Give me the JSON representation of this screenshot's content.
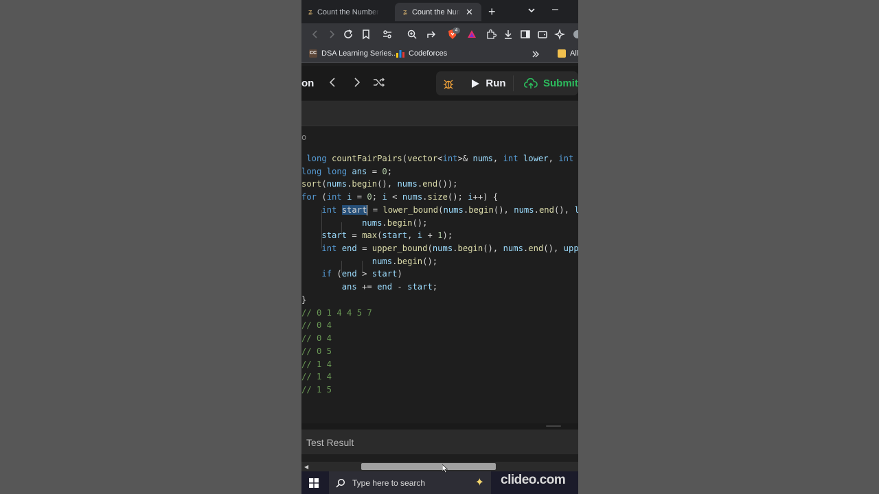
{
  "browser": {
    "tabs": [
      {
        "title": "Count the Number o"
      },
      {
        "title": "Count the Numb",
        "active": true
      }
    ],
    "bookmarks": [
      {
        "label": "DSA Learning Series..."
      },
      {
        "label": "Codeforces"
      },
      {
        "label": "All"
      }
    ],
    "brave_badge": "4"
  },
  "leetcode": {
    "title_fragment": "on",
    "run_label": "Run",
    "submit_label": "Submit",
    "test_result_label": "Test Result"
  },
  "editor": {
    "ghost_text": "o",
    "lines": [
      [
        {
          "t": " "
        },
        {
          "t": "long ",
          "k": "kw"
        },
        {
          "t": "countFairPairs",
          "k": "fn"
        },
        {
          "t": "("
        },
        {
          "t": "vector",
          "k": "fn"
        },
        {
          "t": "<"
        },
        {
          "t": "int",
          "k": "kw"
        },
        {
          "t": ">& "
        },
        {
          "t": "nums",
          "k": "var"
        },
        {
          "t": ", "
        },
        {
          "t": "int ",
          "k": "kw"
        },
        {
          "t": "lower",
          "k": "var"
        },
        {
          "t": ", "
        },
        {
          "t": "int",
          "k": "kw"
        }
      ],
      [
        {
          "t": "long long ",
          "k": "kw"
        },
        {
          "t": "ans",
          "k": "var"
        },
        {
          "t": " = "
        },
        {
          "t": "0",
          "k": "num"
        },
        {
          "t": ";"
        }
      ],
      [
        {
          "t": "sort",
          "k": "fn"
        },
        {
          "t": "("
        },
        {
          "t": "nums",
          "k": "var"
        },
        {
          "t": "."
        },
        {
          "t": "begin",
          "k": "fn"
        },
        {
          "t": "(), "
        },
        {
          "t": "nums",
          "k": "var"
        },
        {
          "t": "."
        },
        {
          "t": "end",
          "k": "fn"
        },
        {
          "t": "());"
        }
      ],
      [
        {
          "t": "for ",
          "k": "kw"
        },
        {
          "t": "("
        },
        {
          "t": "int ",
          "k": "kw"
        },
        {
          "t": "i",
          "k": "var"
        },
        {
          "t": " = "
        },
        {
          "t": "0",
          "k": "num"
        },
        {
          "t": "; "
        },
        {
          "t": "i",
          "k": "var"
        },
        {
          "t": " < "
        },
        {
          "t": "nums",
          "k": "var"
        },
        {
          "t": "."
        },
        {
          "t": "size",
          "k": "fn"
        },
        {
          "t": "(); "
        },
        {
          "t": "i",
          "k": "var"
        },
        {
          "t": "++) {"
        }
      ],
      [
        {
          "t": "    "
        },
        {
          "t": "int ",
          "k": "kw"
        },
        {
          "t": "start",
          "k": "sel"
        },
        {
          "t": "",
          "k": "cur"
        },
        {
          "t": " = "
        },
        {
          "t": "lower_bound",
          "k": "fn"
        },
        {
          "t": "("
        },
        {
          "t": "nums",
          "k": "var"
        },
        {
          "t": "."
        },
        {
          "t": "begin",
          "k": "fn"
        },
        {
          "t": "(), "
        },
        {
          "t": "nums",
          "k": "var"
        },
        {
          "t": "."
        },
        {
          "t": "end",
          "k": "fn"
        },
        {
          "t": "(), "
        },
        {
          "t": "l",
          "k": "var"
        }
      ],
      [
        {
          "t": "            "
        },
        {
          "t": "nums",
          "k": "var"
        },
        {
          "t": "."
        },
        {
          "t": "begin",
          "k": "fn"
        },
        {
          "t": "();"
        }
      ],
      [
        {
          "t": "    "
        },
        {
          "t": "start",
          "k": "var"
        },
        {
          "t": " = "
        },
        {
          "t": "max",
          "k": "fn"
        },
        {
          "t": "("
        },
        {
          "t": "start",
          "k": "var"
        },
        {
          "t": ", "
        },
        {
          "t": "i",
          "k": "var"
        },
        {
          "t": " + "
        },
        {
          "t": "1",
          "k": "num"
        },
        {
          "t": ");"
        }
      ],
      [
        {
          "t": "    "
        },
        {
          "t": "int ",
          "k": "kw"
        },
        {
          "t": "end",
          "k": "var"
        },
        {
          "t": " = "
        },
        {
          "t": "upper_bound",
          "k": "fn"
        },
        {
          "t": "("
        },
        {
          "t": "nums",
          "k": "var"
        },
        {
          "t": "."
        },
        {
          "t": "begin",
          "k": "fn"
        },
        {
          "t": "(), "
        },
        {
          "t": "nums",
          "k": "var"
        },
        {
          "t": "."
        },
        {
          "t": "end",
          "k": "fn"
        },
        {
          "t": "(), "
        },
        {
          "t": "upp",
          "k": "var"
        }
      ],
      [
        {
          "t": "              "
        },
        {
          "t": "nums",
          "k": "var"
        },
        {
          "t": "."
        },
        {
          "t": "begin",
          "k": "fn"
        },
        {
          "t": "();"
        }
      ],
      [
        {
          "t": "    "
        },
        {
          "t": "if ",
          "k": "kw"
        },
        {
          "t": "("
        },
        {
          "t": "end",
          "k": "var"
        },
        {
          "t": " > "
        },
        {
          "t": "start",
          "k": "var"
        },
        {
          "t": ")"
        }
      ],
      [
        {
          "t": "        "
        },
        {
          "t": "ans",
          "k": "var"
        },
        {
          "t": " += "
        },
        {
          "t": "end",
          "k": "var"
        },
        {
          "t": " - "
        },
        {
          "t": "start",
          "k": "var"
        },
        {
          "t": ";"
        }
      ],
      [
        {
          "t": "}"
        }
      ],
      [
        {
          "t": "// 0 1 4 4 5 7",
          "k": "cm"
        }
      ],
      [
        {
          "t": "// 0 4",
          "k": "cm"
        }
      ],
      [
        {
          "t": "// 0 4",
          "k": "cm"
        }
      ],
      [
        {
          "t": "// 0 5",
          "k": "cm"
        }
      ],
      [
        {
          "t": "// 1 4",
          "k": "cm"
        }
      ],
      [
        {
          "t": "// 1 4",
          "k": "cm"
        }
      ],
      [
        {
          "t": "// 1 5",
          "k": "cm"
        }
      ]
    ]
  },
  "taskbar": {
    "search_placeholder": "Type here to search",
    "watermark": "clideo.com"
  },
  "colors": {
    "accent_green": "#2cbb5d",
    "selection": "#264f78",
    "keyword": "#569cd6",
    "function": "#dcdcaa",
    "variable": "#9cdcfe",
    "comment": "#6a9955"
  },
  "icons": {
    "tab_favicon": "leetcode-icon",
    "start": "windows-icon",
    "search": "search-icon"
  }
}
